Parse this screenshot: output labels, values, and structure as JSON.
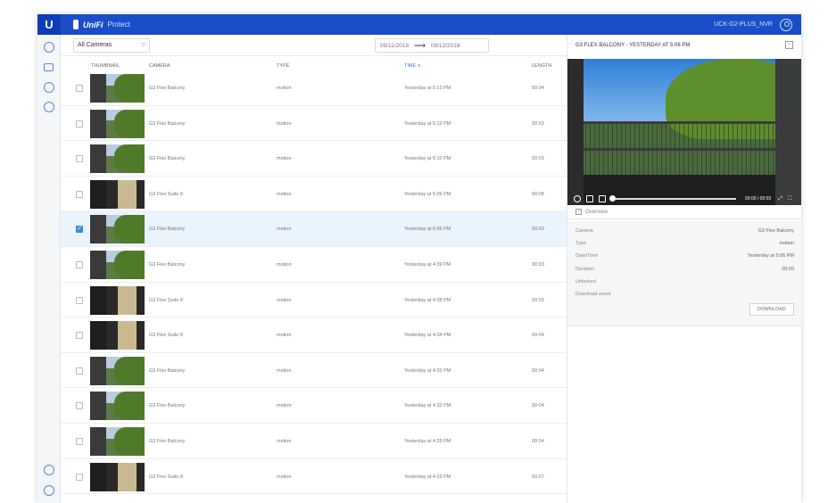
{
  "header": {
    "logo": "U",
    "brand": "UniFi",
    "app_name": "Protect",
    "device": "UCK-G2-PLUS_NVR"
  },
  "toolbar": {
    "camera_filter": "All Cameras",
    "date_from": "09/11/2018",
    "date_to": "09/12/2018"
  },
  "table": {
    "columns": [
      "THUMBNAIL",
      "CAMERA",
      "TYPE",
      "TIME",
      "LENGTH"
    ],
    "rows": [
      {
        "camera": "G3 Flex Balcony",
        "type": "motion",
        "time": "Yesterday at 5:13 PM",
        "length": "00:04",
        "thumb": "balcony",
        "selected": false
      },
      {
        "camera": "G3 Flex Balcony",
        "type": "motion",
        "time": "Yesterday at 5:12 PM",
        "length": "00:03",
        "thumb": "balcony",
        "selected": false
      },
      {
        "camera": "G3 Flex Balcony",
        "type": "motion",
        "time": "Yesterday at 5:10 PM",
        "length": "00:03",
        "thumb": "balcony",
        "selected": false
      },
      {
        "camera": "G3 Flex Suite 8",
        "type": "motion",
        "time": "Yesterday at 5:09 PM",
        "length": "00:08",
        "thumb": "suite",
        "selected": false
      },
      {
        "camera": "G3 Flex Balcony",
        "type": "motion",
        "time": "Yesterday at 5:06 PM",
        "length": "00:03",
        "thumb": "balcony",
        "selected": true
      },
      {
        "camera": "G3 Flex Balcony",
        "type": "motion",
        "time": "Yesterday at 4:39 PM",
        "length": "00:03",
        "thumb": "balcony",
        "selected": false
      },
      {
        "camera": "G3 Flex Suite 8",
        "type": "motion",
        "time": "Yesterday at 4:38 PM",
        "length": "00:03",
        "thumb": "suite",
        "selected": false
      },
      {
        "camera": "G3 Flex Suite 8",
        "type": "motion",
        "time": "Yesterday at 4:34 PM",
        "length": "00:04",
        "thumb": "suite",
        "selected": false
      },
      {
        "camera": "G3 Flex Balcony",
        "type": "motion",
        "time": "Yesterday at 4:33 PM",
        "length": "00:04",
        "thumb": "balcony",
        "selected": false
      },
      {
        "camera": "G3 Flex Balcony",
        "type": "motion",
        "time": "Yesterday at 4:32 PM",
        "length": "00:04",
        "thumb": "balcony",
        "selected": false
      },
      {
        "camera": "G3 Flex Balcony",
        "type": "motion",
        "time": "Yesterday at 4:25 PM",
        "length": "00:04",
        "thumb": "balcony",
        "selected": false
      },
      {
        "camera": "G3 Flex Suite 8",
        "type": "motion",
        "time": "Yesterday at 4:23 PM",
        "length": "00:07",
        "thumb": "suite",
        "selected": false
      }
    ]
  },
  "panel": {
    "title": "G3 FLEX BALCONY - YESTERDAY AT 5:06 PM",
    "close_icon": "minus-box-icon",
    "player": {
      "time": "00:00 / 00:03",
      "progress": 0.0
    },
    "overview_label": "Overview",
    "details": [
      {
        "label": "Camera",
        "value": "G3 Flex Balcony"
      },
      {
        "label": "Type",
        "value": "motion"
      },
      {
        "label": "Date/Time",
        "value": "Yesterday at 5:06 PM"
      },
      {
        "label": "Duration",
        "value": "00:03"
      },
      {
        "label": "Unlocked",
        "value": ""
      },
      {
        "label": "Download event",
        "value": ""
      }
    ],
    "download_label": "DOWNLOAD"
  },
  "colors": {
    "topbar": "#1a4dc9",
    "accent": "#3a8ae0",
    "selected_row": "#eaf4fd"
  }
}
